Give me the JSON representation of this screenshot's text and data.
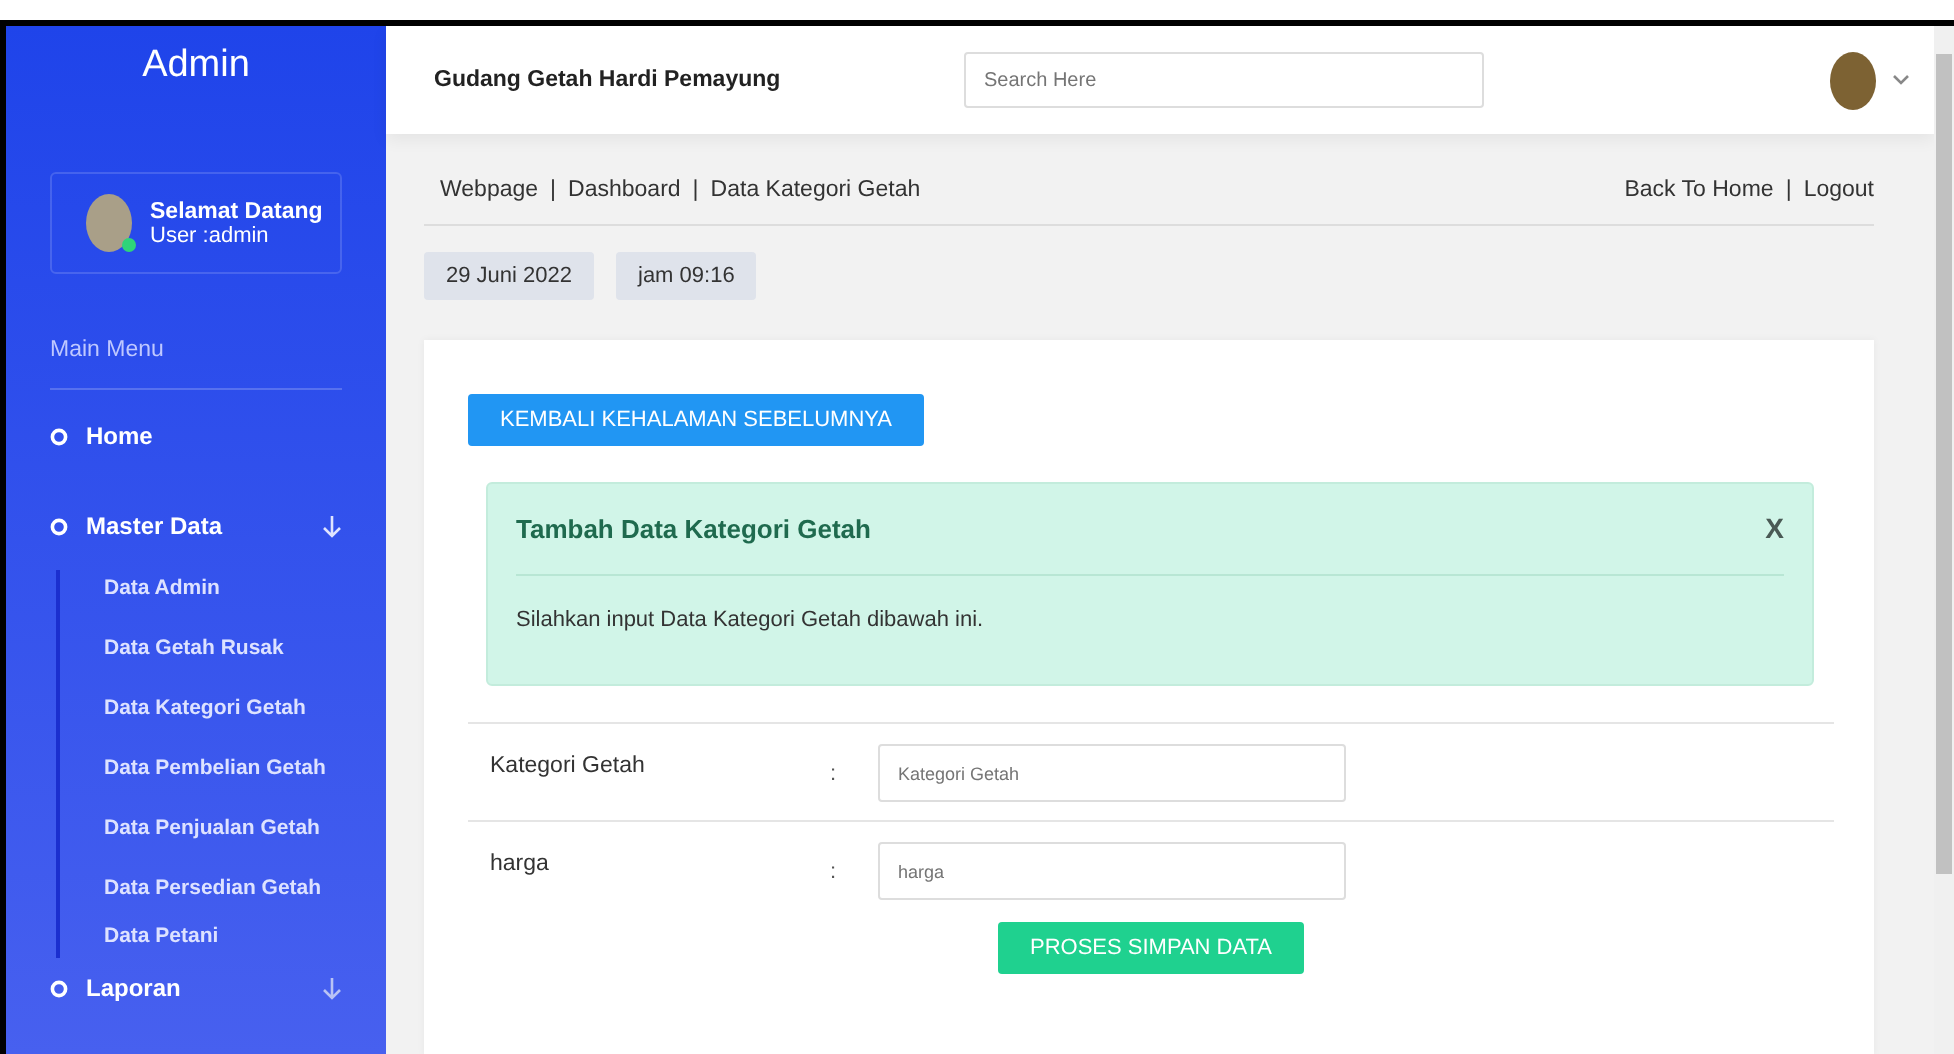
{
  "sidebar": {
    "title": "Admin",
    "user": {
      "greeting": "Selamat Datang",
      "username": "User :admin",
      "online": true
    },
    "menu_heading": "Main Menu",
    "items": [
      {
        "label": "Home"
      },
      {
        "label": "Master Data",
        "expanded": true,
        "children": [
          {
            "label": "Data Admin"
          },
          {
            "label": "Data Getah Rusak"
          },
          {
            "label": "Data Kategori Getah"
          },
          {
            "label": "Data Pembelian Getah"
          },
          {
            "label": "Data Penjualan Getah"
          },
          {
            "label": "Data Persedian Getah"
          },
          {
            "label": "Data Petani"
          }
        ]
      },
      {
        "label": "Laporan",
        "expanded": false
      }
    ]
  },
  "header": {
    "title": "Gudang Getah Hardi Pemayung",
    "search": {
      "placeholder": "Search Here"
    }
  },
  "breadcrumb": [
    "Webpage",
    "|",
    "Dashboard",
    "|",
    "Data Kategori Getah"
  ],
  "top_links": [
    "Back To Home",
    "|",
    "Logout"
  ],
  "date": "29 Juni 2022",
  "time": "jam 09:16",
  "back_button": "KEMBALI KEHALAMAN SEBELUMNYA",
  "alert": {
    "title": "Tambah Data Kategori Getah",
    "close": "X",
    "message": "Silahkan input Data Kategori Getah dibawah ini."
  },
  "form": {
    "fields": [
      {
        "label": "Kategori Getah",
        "separator": ":",
        "placeholder": "Kategori Getah"
      },
      {
        "label": "harga",
        "separator": ":",
        "placeholder": "harga"
      }
    ],
    "submit": "PROSES SIMPAN DATA"
  }
}
